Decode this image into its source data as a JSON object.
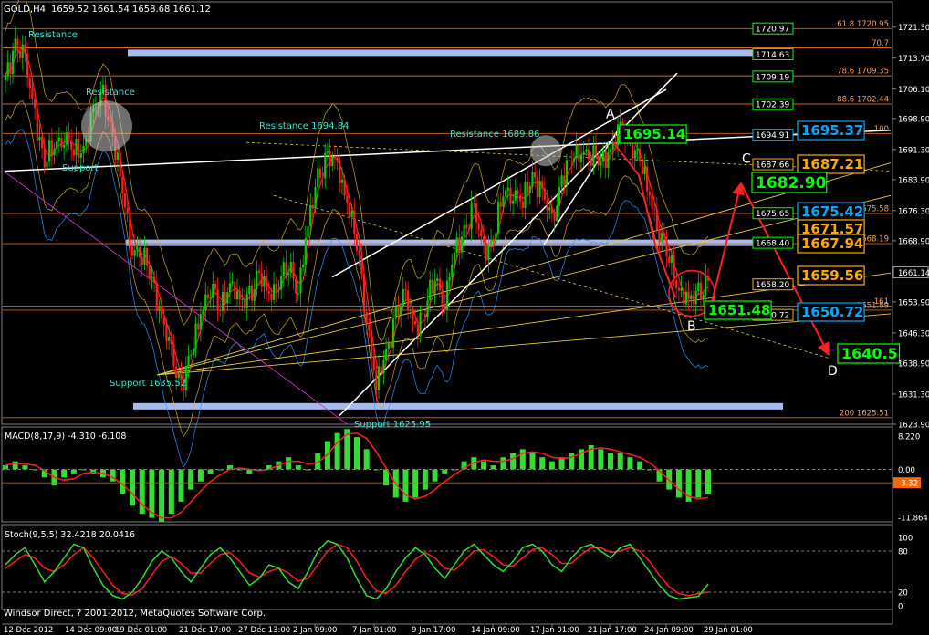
{
  "header": {
    "symbol": "GOLD,H4",
    "ohlc": "1659.52 1661.54 1658.68 1661.12"
  },
  "colors": {
    "background": "#000000",
    "frame": "#808080",
    "candle_up": "#00cc00",
    "candle_down": "#ff2020",
    "hline": "#d2691e",
    "annotation_cyan": "#40e0d0",
    "red_path": "#ff2020",
    "white_line": "#ffffff",
    "yellow_line": "#e6c84a",
    "blue_zone": "#b0c4ff",
    "box_green": "#00ff00",
    "box_blue": "#00aaff",
    "box_orange": "#ffaa00",
    "macd_hist": "#33dd33",
    "macd_signal": "#ff2020",
    "stoch_main": "#33dd33",
    "stoch_signal": "#ff2020"
  },
  "chart_data": [
    {
      "type": "candlestick",
      "title": "GOLD,H4 1659.52 1661.54 1658.68 1661.12",
      "ylim": [
        1623.9,
        1727.5
      ],
      "y_ticks": [
        1721.3,
        1713.7,
        1706.1,
        1698.9,
        1691.3,
        1683.9,
        1676.3,
        1668.9,
        1661.14,
        1653.9,
        1646.3,
        1638.9,
        1631.3,
        1623.9
      ],
      "current_price": "1661.14",
      "x_tick_labels": [
        "12 Dec 2012",
        "14 Dec 09:00",
        "19 Dec 01:00",
        "21 Dec 17:00",
        "27 Dec 13:00",
        "2 Jan 09:00",
        "7 Jan 01:00",
        "9 Jan 17:00",
        "14 Jan 09:00",
        "17 Jan 01:00",
        "21 Jan 17:00",
        "24 Jan 09:00",
        "29 Jan 01:00"
      ],
      "close_path": [
        1708,
        1718,
        1712,
        1700,
        1688,
        1692,
        1696,
        1690,
        1692,
        1700,
        1704,
        1695,
        1680,
        1668,
        1665,
        1660,
        1650,
        1640,
        1634,
        1640,
        1652,
        1658,
        1652,
        1660,
        1652,
        1656,
        1660,
        1655,
        1660,
        1662,
        1658,
        1672,
        1684,
        1690,
        1686,
        1680,
        1668,
        1650,
        1634,
        1640,
        1652,
        1654,
        1648,
        1652,
        1660,
        1655,
        1665,
        1672,
        1676,
        1666,
        1670,
        1680,
        1682,
        1678,
        1685,
        1681,
        1672,
        1685,
        1688,
        1692,
        1690,
        1688,
        1692,
        1695,
        1694,
        1688,
        1680,
        1672,
        1664,
        1658,
        1653,
        1656,
        1659
      ],
      "horizontal_levels": [
        {
          "label": "61.8  1720.95",
          "value": 1720.95
        },
        {
          "label": "70.7",
          "value": 1716.2
        },
        {
          "label": "78.6  1709.35",
          "value": 1709.35
        },
        {
          "label": "88.6  1702.44",
          "value": 1702.44
        },
        {
          "label": "100",
          "value": 1695.2
        },
        {
          "label": "1675.58",
          "value": 1675.58
        },
        {
          "label": "1668.19",
          "value": 1668.19
        },
        {
          "label": "161",
          "value": 1652.9
        },
        {
          "label": "1651.89",
          "value": 1651.89
        },
        {
          "label": "200  1625.51",
          "value": 1625.51
        }
      ],
      "level_boxes": [
        {
          "text": "1720.97",
          "value": 1720.97,
          "color": "green"
        },
        {
          "text": "1714.63",
          "value": 1714.63,
          "color": "green"
        },
        {
          "text": "1709.19",
          "value": 1709.19,
          "color": "green"
        },
        {
          "text": "1702.39",
          "value": 1702.39,
          "color": "green"
        },
        {
          "text": "1694.91",
          "value": 1694.91,
          "color": "blue"
        },
        {
          "text": "1687.66",
          "value": 1687.66,
          "color": "orange"
        },
        {
          "text": "1675.65",
          "value": 1675.65,
          "color": "green"
        },
        {
          "text": "1668.40",
          "value": 1668.4,
          "color": "green"
        },
        {
          "text": "1658.20",
          "value": 1658.2,
          "color": "orange"
        },
        {
          "text": "1650.72",
          "value": 1650.72,
          "color": "orange"
        }
      ],
      "big_labels": [
        {
          "text": "1695.14",
          "color": "green"
        },
        {
          "text": "1695.37",
          "color": "blue"
        },
        {
          "text": "1687.21",
          "color": "orange"
        },
        {
          "text": "1682.90",
          "color": "green"
        },
        {
          "text": "1675.42",
          "color": "blue"
        },
        {
          "text": "1671.57",
          "color": "orange"
        },
        {
          "text": "1667.94",
          "color": "orange"
        },
        {
          "text": "1659.56",
          "color": "orange"
        },
        {
          "text": "1651.48",
          "color": "green"
        },
        {
          "text": "1650.72",
          "color": "blue"
        },
        {
          "text": "1640.5",
          "color": "green"
        }
      ],
      "annotations": [
        "Resistance",
        "Resistance",
        "Support",
        "Resistance  1694.84",
        "Resistance  1689.86",
        "Support  1635.52",
        "Support  1625.95"
      ],
      "pattern_points": [
        "A",
        "B",
        "C",
        "D"
      ]
    },
    {
      "type": "bar",
      "title": "MACD(8,17,9) -4.310 -6.108",
      "ylim": [
        -13.0,
        10.5
      ],
      "y_ticks": [
        8.22,
        0.0,
        -3.32,
        -11.864
      ],
      "y_tick_labels": [
        "8.220",
        "0.00",
        "-3.32",
        "-11.864"
      ],
      "histogram": [
        1,
        2,
        1,
        0,
        -2,
        -4,
        -2,
        -1,
        0,
        -1,
        -2,
        -3,
        -6,
        -9,
        -11,
        -12,
        -13,
        -11,
        -8,
        -5,
        -3,
        -1,
        0,
        1,
        0,
        -1,
        0,
        1,
        2,
        3,
        1,
        0,
        4,
        7,
        9,
        10,
        8,
        5,
        0,
        -4,
        -7,
        -8,
        -7,
        -5,
        -3,
        -1,
        0,
        2,
        3,
        2,
        1,
        3,
        4,
        5,
        4,
        3,
        2,
        3,
        4,
        5,
        6,
        5,
        4,
        4,
        3,
        2,
        0,
        -3,
        -5,
        -7,
        -8,
        -7,
        -6
      ],
      "signal_level": -3.32
    },
    {
      "type": "line",
      "title": "Stoch(9,5,5) 32.4218 20.0416",
      "ylim": [
        0,
        100
      ],
      "y_ticks": [
        100,
        80,
        20,
        0
      ],
      "main_line": [
        60,
        75,
        85,
        60,
        35,
        50,
        70,
        90,
        85,
        55,
        30,
        15,
        10,
        20,
        40,
        65,
        80,
        70,
        50,
        35,
        55,
        75,
        85,
        70,
        50,
        30,
        40,
        60,
        55,
        35,
        25,
        50,
        80,
        95,
        90,
        70,
        40,
        15,
        10,
        25,
        50,
        70,
        85,
        75,
        55,
        40,
        60,
        80,
        90,
        75,
        60,
        50,
        65,
        85,
        90,
        80,
        60,
        50,
        70,
        85,
        90,
        80,
        70,
        85,
        90,
        70,
        50,
        30,
        15,
        10,
        12,
        14,
        32
      ],
      "signal_line": [
        55,
        65,
        75,
        70,
        55,
        50,
        60,
        75,
        85,
        70,
        50,
        30,
        18,
        16,
        25,
        45,
        65,
        72,
        62,
        48,
        48,
        62,
        75,
        78,
        65,
        48,
        42,
        50,
        55,
        48,
        36,
        40,
        60,
        80,
        90,
        85,
        65,
        40,
        22,
        18,
        30,
        50,
        68,
        78,
        70,
        55,
        52,
        65,
        80,
        82,
        72,
        60,
        58,
        70,
        82,
        85,
        75,
        62,
        62,
        75,
        85,
        85,
        78,
        80,
        85,
        80,
        65,
        45,
        28,
        18,
        15,
        18,
        20
      ]
    }
  ],
  "footer": {
    "copyright": "Windsor Direct, ? 2001-2012, MetaQuotes Software Corp."
  }
}
